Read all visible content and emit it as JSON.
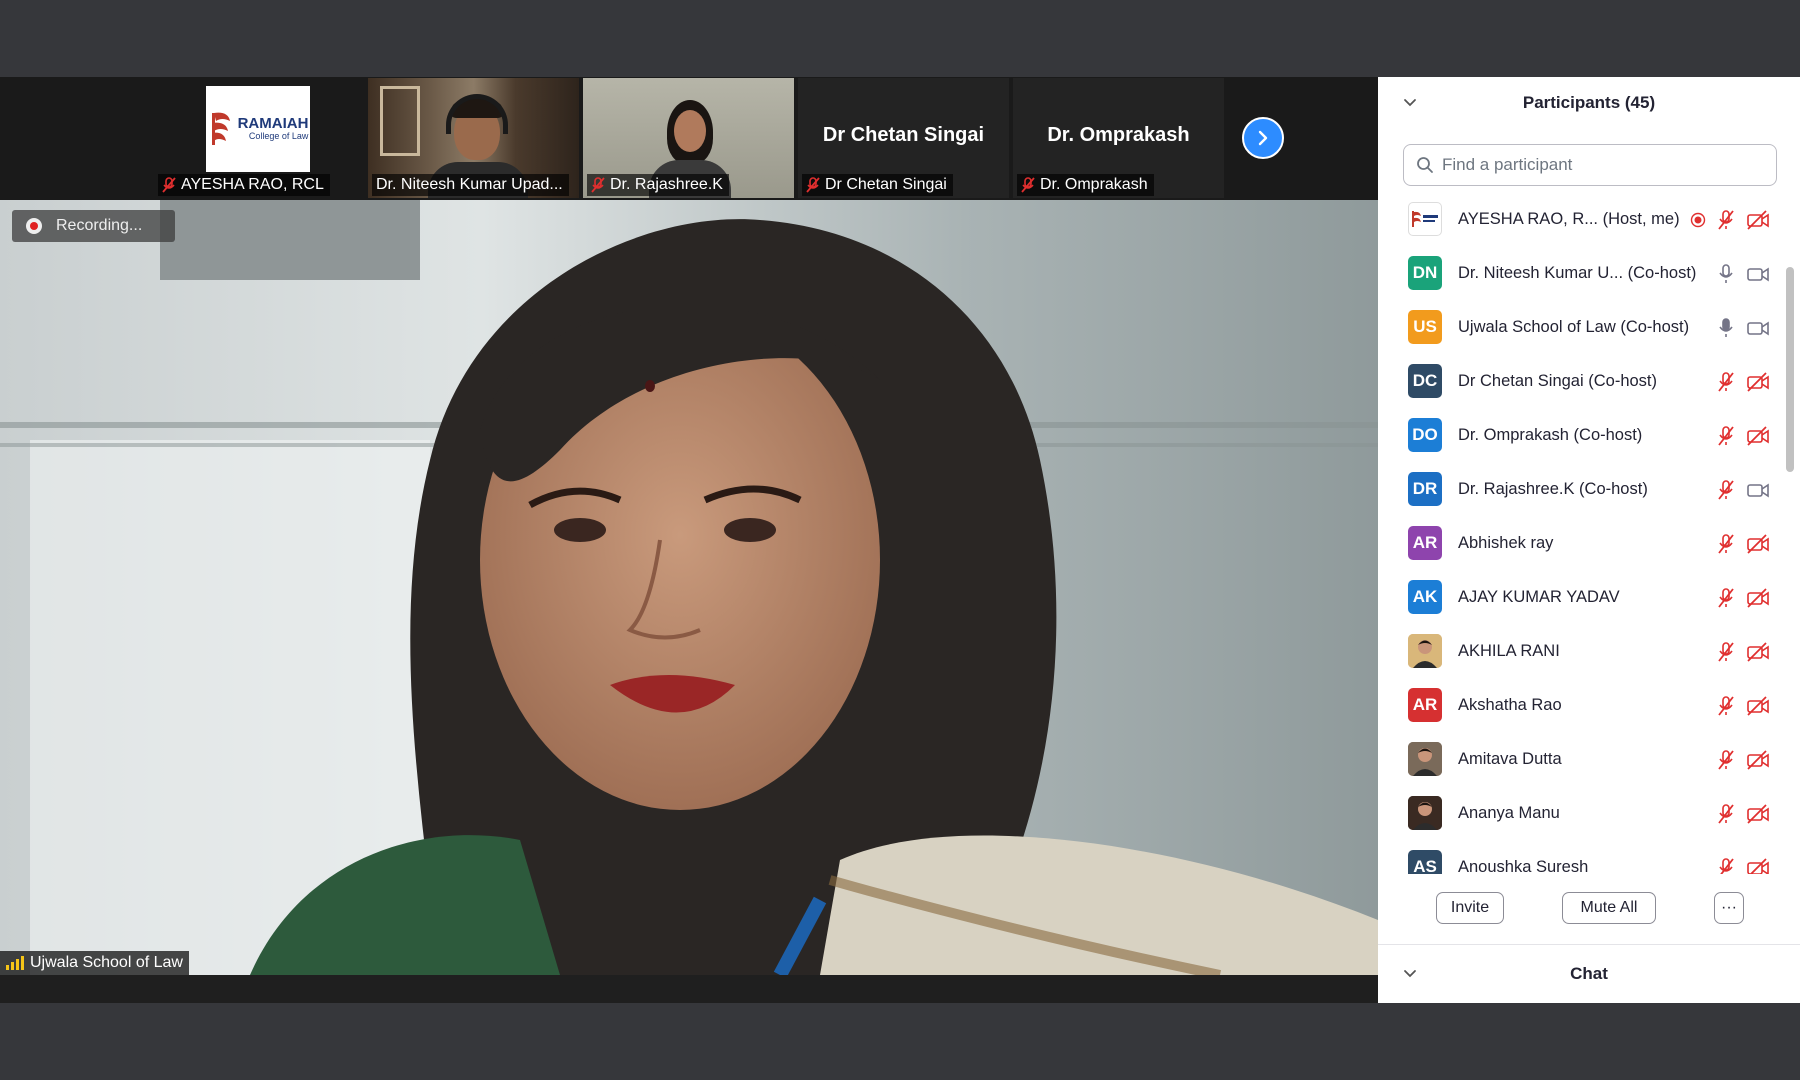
{
  "strip": {
    "tiles": [
      {
        "label": "AYESHA RAO, RCL",
        "muted": true,
        "kind": "logo",
        "logo_main": "RAMAIAH",
        "logo_sub": "College of Law"
      },
      {
        "label": "Dr. Niteesh Kumar Upad...",
        "muted": false,
        "kind": "video"
      },
      {
        "label": "Dr. Rajashree.K",
        "muted": true,
        "kind": "video"
      },
      {
        "label": "Dr Chetan Singai",
        "muted": true,
        "kind": "name",
        "display_name": "Dr Chetan Singai"
      },
      {
        "label": "Dr. Omprakash",
        "muted": true,
        "kind": "name",
        "display_name": "Dr. Omprakash"
      }
    ],
    "next_icon": "chevron-right-icon"
  },
  "main_video": {
    "recording_label": "Recording...",
    "active_speaker": "Ujwala School of Law"
  },
  "panel": {
    "title": "Participants (45)",
    "search_placeholder": "Find a participant",
    "participants": [
      {
        "initials": "",
        "color": "#ffffff",
        "name": "AYESHA RAO, R...  (Host, me)",
        "mic": "muted",
        "cam": "off",
        "recording": true,
        "avatar": "logo"
      },
      {
        "initials": "DN",
        "color": "#1aa37a",
        "name": "Dr. Niteesh Kumar U...  (Co-host)",
        "mic": "on",
        "cam": "on"
      },
      {
        "initials": "US",
        "color": "#f29b1d",
        "name": "Ujwala School of Law (Co-host)",
        "mic": "active",
        "cam": "on"
      },
      {
        "initials": "DC",
        "color": "#2f4b66",
        "name": "Dr Chetan Singai (Co-host)",
        "mic": "muted",
        "cam": "off"
      },
      {
        "initials": "DO",
        "color": "#1c7ed6",
        "name": "Dr. Omprakash (Co-host)",
        "mic": "muted",
        "cam": "off"
      },
      {
        "initials": "DR",
        "color": "#1c6fc4",
        "name": "Dr. Rajashree.K (Co-host)",
        "mic": "muted",
        "cam": "on"
      },
      {
        "initials": "AR",
        "color": "#8e44ad",
        "name": "Abhishek ray",
        "mic": "muted",
        "cam": "off"
      },
      {
        "initials": "AK",
        "color": "#1c7ed6",
        "name": "AJAY KUMAR YADAV",
        "mic": "muted",
        "cam": "off"
      },
      {
        "initials": "",
        "color": "#d9b77a",
        "name": "AKHILA RANI",
        "mic": "muted",
        "cam": "off",
        "avatar": "photo"
      },
      {
        "initials": "AR",
        "color": "#d63031",
        "name": "Akshatha Rao",
        "mic": "muted",
        "cam": "off"
      },
      {
        "initials": "",
        "color": "#7a6a5a",
        "name": "Amitava Dutta",
        "mic": "muted",
        "cam": "off",
        "avatar": "photo"
      },
      {
        "initials": "",
        "color": "#3a2a22",
        "name": "Ananya Manu",
        "mic": "muted",
        "cam": "off",
        "avatar": "photo"
      },
      {
        "initials": "AS",
        "color": "#2f4b66",
        "name": "Anoushka Suresh",
        "mic": "muted",
        "cam": "off"
      }
    ],
    "invite_label": "Invite",
    "mute_all_label": "Mute All",
    "more_label": "···",
    "chat_title": "Chat"
  },
  "colors": {
    "accent": "#2d8cff",
    "muted_red": "#e02f2f",
    "panel_bg": "#ffffff",
    "app_bg": "#36373b"
  }
}
